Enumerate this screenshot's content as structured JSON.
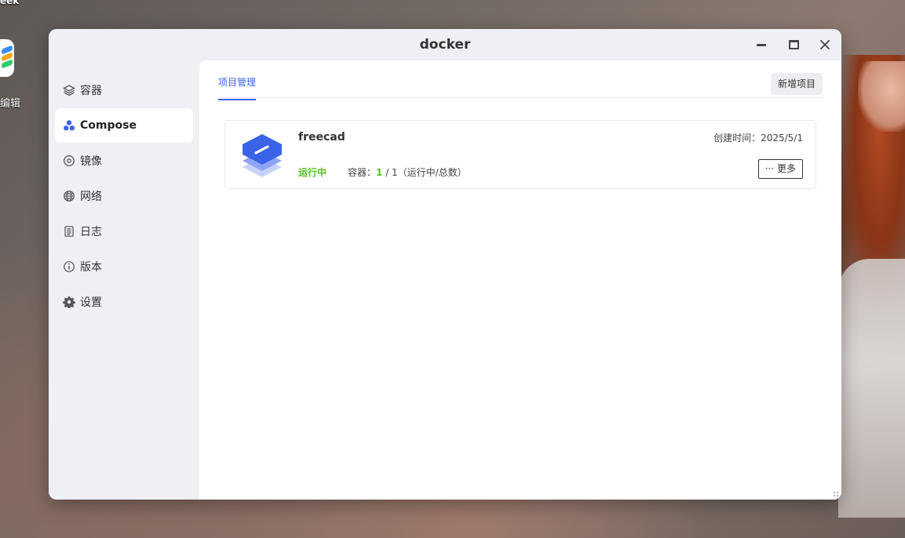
{
  "desktop": {
    "top_label": "eek",
    "app_label": "编辑"
  },
  "window": {
    "title": "docker"
  },
  "sidebar": {
    "items": [
      {
        "label": "容器",
        "icon": "layers-icon"
      },
      {
        "label": "Compose",
        "icon": "compose-icon",
        "active": true
      },
      {
        "label": "镜像",
        "icon": "disc-icon"
      },
      {
        "label": "网络",
        "icon": "globe-icon"
      },
      {
        "label": "日志",
        "icon": "document-icon"
      },
      {
        "label": "版本",
        "icon": "info-icon"
      },
      {
        "label": "设置",
        "icon": "gear-icon"
      }
    ]
  },
  "main": {
    "tab_label": "项目管理",
    "add_button": "新增项目",
    "project": {
      "name": "freecad",
      "status": "运行中",
      "containers_label": "容器：",
      "running": "1",
      "containers_total": " / 1（运行中/总数）",
      "created_label": "创建时间：2025/5/1",
      "more_button": "··· 更多"
    }
  },
  "colors": {
    "accent": "#3b63e8",
    "running": "#52c41a"
  }
}
